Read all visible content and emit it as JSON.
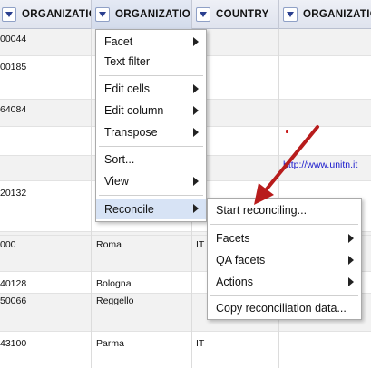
{
  "header": {
    "columns": [
      {
        "label": "ORGANIZATIO"
      },
      {
        "label": "ORGANIZATIO"
      },
      {
        "label": "COUNTRY"
      },
      {
        "label": "ORGANIZATIO"
      }
    ]
  },
  "rows": [
    {
      "id": "00044",
      "city": "",
      "country": "",
      "url": ""
    },
    {
      "id": "00185",
      "city": "",
      "country": "",
      "url": ""
    },
    {
      "id": "64084",
      "city": "",
      "country": "",
      "url": ""
    },
    {
      "id": "",
      "city": "",
      "country": "",
      "url": ""
    },
    {
      "id": "",
      "city": "",
      "country": "",
      "url": "http://www.unitn.it"
    },
    {
      "id": "20132",
      "city": "",
      "country": "",
      "url": ""
    },
    {
      "id": "",
      "city": "",
      "country": "",
      "url": ""
    },
    {
      "id": "000",
      "city": "Roma",
      "country": "IT",
      "url": ""
    },
    {
      "id": "",
      "city": "",
      "country": "",
      "url": ""
    },
    {
      "id": "40128",
      "city": "Bologna",
      "country": "IT",
      "url": ""
    },
    {
      "id": "50066",
      "city": "Reggello",
      "country": "IT",
      "url": ""
    },
    {
      "id": "",
      "city": "",
      "country": "",
      "url": ""
    },
    {
      "id": "43100",
      "city": "Parma",
      "country": "IT",
      "url": ""
    }
  ],
  "column_menu": {
    "items": [
      {
        "label": "Facet"
      },
      {
        "label": "Text filter"
      },
      {
        "label": "Edit cells"
      },
      {
        "label": "Edit column"
      },
      {
        "label": "Transpose"
      },
      {
        "label": "Sort..."
      },
      {
        "label": "View"
      },
      {
        "label": "Reconcile"
      }
    ]
  },
  "reconcile_menu": {
    "items": [
      {
        "label": "Start reconciling..."
      },
      {
        "label": "Facets"
      },
      {
        "label": "QA facets"
      },
      {
        "label": "Actions"
      },
      {
        "label": "Copy reconciliation data..."
      }
    ]
  },
  "colors": {
    "highlight": "#d7e3f5",
    "annotation_arrow": "#b81c1c",
    "link": "#1a1acc"
  }
}
